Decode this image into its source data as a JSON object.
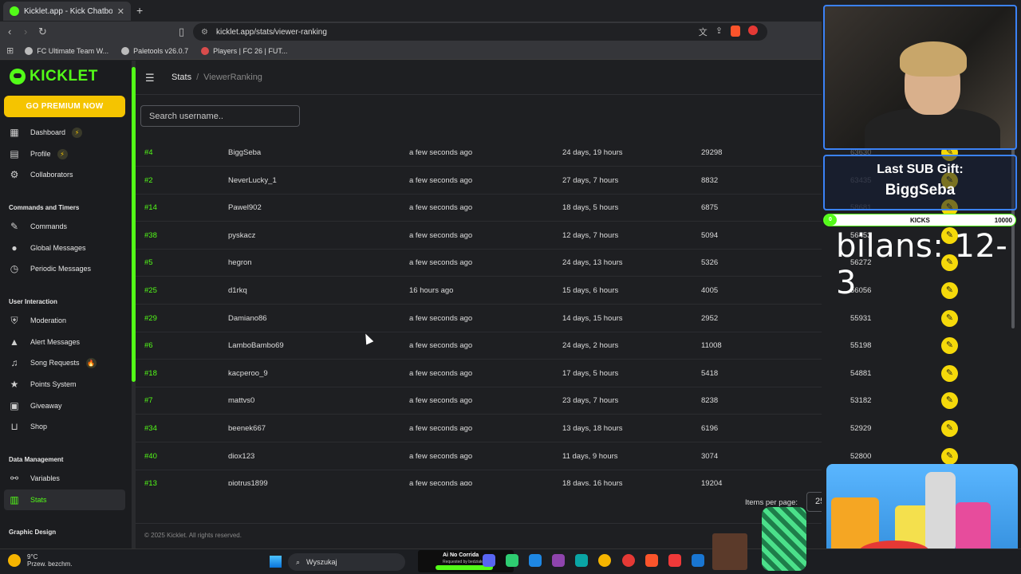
{
  "browser": {
    "tab_title": "Kicklet.app - Kick Chatbot and C",
    "url": "kicklet.app/stats/viewer-ranking",
    "bookmarks": [
      "FC Ultimate Team W...",
      "Paletools v26.0.7",
      "Players | FC 26 | FUT..."
    ]
  },
  "sidebar": {
    "logo": "KICKLET",
    "premium_label": "GO PREMIUM NOW",
    "items": [
      {
        "label": "Dashboard",
        "icon": "grid-icon",
        "badge": "⚡"
      },
      {
        "label": "Profile",
        "icon": "profile-icon",
        "badge": "⚡"
      },
      {
        "label": "Collaborators",
        "icon": "collaborators-icon"
      },
      {
        "label": "Commands",
        "icon": "wrench-icon"
      },
      {
        "label": "Global Messages",
        "icon": "chat-icon"
      },
      {
        "label": "Periodic Messages",
        "icon": "clock-icon"
      },
      {
        "label": "Moderation",
        "icon": "shield-icon"
      },
      {
        "label": "Alert Messages",
        "icon": "alert-icon"
      },
      {
        "label": "Song Requests",
        "icon": "music-icon",
        "badge": "🔥"
      },
      {
        "label": "Points System",
        "icon": "star-icon"
      },
      {
        "label": "Giveaway",
        "icon": "gift-icon"
      },
      {
        "label": "Shop",
        "icon": "cart-icon"
      },
      {
        "label": "Variables",
        "icon": "link-icon"
      },
      {
        "label": "Stats",
        "icon": "bar-chart-icon"
      }
    ],
    "sections": [
      "Commands and Timers",
      "User Interaction",
      "Data Management",
      "Graphic Design"
    ]
  },
  "main": {
    "breadcrumb": {
      "root": "Stats",
      "current": "ViewerRanking"
    },
    "search_placeholder": "Search username..",
    "rows": [
      {
        "rank": "#4",
        "user": "BiggSeba",
        "seen": "a few seconds ago",
        "watch": "24 days, 19 hours",
        "msgs": "29298",
        "pts": "63630"
      },
      {
        "rank": "#2",
        "user": "NeverLucky_1",
        "seen": "a few seconds ago",
        "watch": "27 days, 7 hours",
        "msgs": "8832",
        "pts": "63435"
      },
      {
        "rank": "#14",
        "user": "Pawel902",
        "seen": "a few seconds ago",
        "watch": "18 days, 5 hours",
        "msgs": "6875",
        "pts": "58681"
      },
      {
        "rank": "#38",
        "user": "pyskacz",
        "seen": "a few seconds ago",
        "watch": "12 days, 7 hours",
        "msgs": "5094",
        "pts": "56453"
      },
      {
        "rank": "#5",
        "user": "hegron",
        "seen": "a few seconds ago",
        "watch": "24 days, 13 hours",
        "msgs": "5326",
        "pts": "56272"
      },
      {
        "rank": "#25",
        "user": "d1rkq",
        "seen": "16 hours ago",
        "watch": "15 days, 6 hours",
        "msgs": "4005",
        "pts": "56056"
      },
      {
        "rank": "#29",
        "user": "Damiano86",
        "seen": "a few seconds ago",
        "watch": "14 days, 15 hours",
        "msgs": "2952",
        "pts": "55931"
      },
      {
        "rank": "#6",
        "user": "LamboBambo69",
        "seen": "a few seconds ago",
        "watch": "24 days, 2 hours",
        "msgs": "11008",
        "pts": "55198"
      },
      {
        "rank": "#18",
        "user": "kacperoo_9",
        "seen": "a few seconds ago",
        "watch": "17 days, 5 hours",
        "msgs": "5418",
        "pts": "54881"
      },
      {
        "rank": "#7",
        "user": "mattvs0",
        "seen": "a few seconds ago",
        "watch": "23 days, 7 hours",
        "msgs": "8238",
        "pts": "53182"
      },
      {
        "rank": "#34",
        "user": "beenek667",
        "seen": "a few seconds ago",
        "watch": "13 days, 18 hours",
        "msgs": "6196",
        "pts": "52929"
      },
      {
        "rank": "#40",
        "user": "diox123",
        "seen": "a few seconds ago",
        "watch": "11 days, 9 hours",
        "msgs": "3074",
        "pts": "52800"
      },
      {
        "rank": "#13",
        "user": "piotrus1899",
        "seen": "a few seconds ago",
        "watch": "18 days, 16 hours",
        "msgs": "19204",
        "pts": ""
      }
    ],
    "items_per_page_label": "Items per page:",
    "items_per_page_value": "25",
    "copyright": "© 2025 Kicklet. All rights reserved."
  },
  "overlay": {
    "sub_gift_title": "Last SUB Gift:",
    "sub_gift_user": "BiggSeba",
    "kicks_start": "0",
    "kicks_label": "KICKS",
    "kicks_max": "10000",
    "bilans": "bilans: 12-3"
  },
  "taskbar": {
    "temperature": "9°C",
    "weather": "Przew. bezchm.",
    "search_label": "Wyszukaj",
    "now_playing_title": "Ai No Corrida",
    "now_playing_sub": "Requested by bedziakuba"
  },
  "colors": {
    "accent": "#53fc18",
    "premium": "#f5c400",
    "edit": "#f5d90a"
  }
}
